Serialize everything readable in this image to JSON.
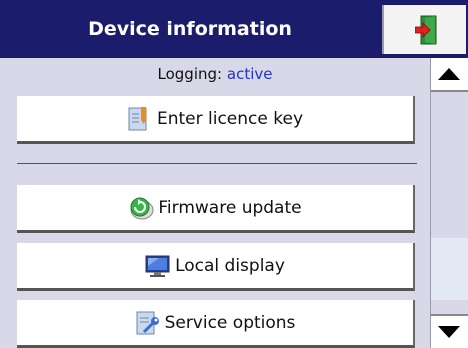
{
  "header": {
    "title": "Device information"
  },
  "status": {
    "logging_label": "Logging:",
    "logging_value": "active"
  },
  "buttons": {
    "licence": "Enter licence key",
    "firmware": "Firmware update",
    "display": "Local display",
    "service": "Service options"
  },
  "icons": {
    "exit": "exit-door-icon",
    "licence": "document-icon",
    "firmware": "update-icon",
    "display": "monitor-icon",
    "service": "wrench-icon"
  },
  "colors": {
    "header_bg": "#1c1c6c",
    "accent": "#2233cc"
  }
}
